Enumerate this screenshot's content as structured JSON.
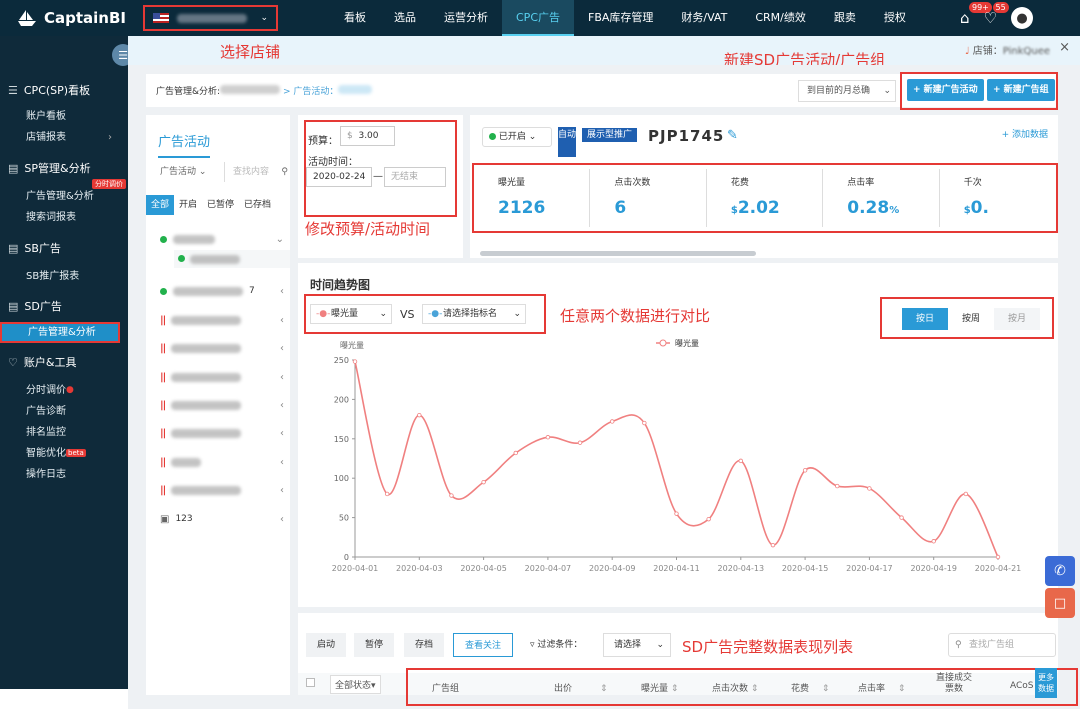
{
  "app": {
    "name": "CaptainBI"
  },
  "nav": [
    "看板",
    "选品",
    "运营分析",
    "CPC广告",
    "FBA库存管理",
    "财务/VAT",
    "CRM/绩效",
    "跟卖",
    "授权"
  ],
  "notifications": {
    "badge1": "99+",
    "badge2": "55"
  },
  "sidebar": {
    "groups": [
      {
        "title": "CPC(SP)看板",
        "items": [
          "账户看板",
          "店铺报表"
        ]
      },
      {
        "title": "SP管理&分析",
        "items": [
          "广告管理&分析",
          "搜索词报表"
        ],
        "tag": "分时调价"
      },
      {
        "title": "SB广告",
        "items": [
          "SB推广报表"
        ]
      },
      {
        "title": "SD广告",
        "items": [
          "广告管理&分析"
        ]
      },
      {
        "title": "账户&工具",
        "items": [
          "分时调价",
          "广告诊断",
          "排名监控",
          "智能优化",
          "操作日志"
        ]
      }
    ],
    "beta": "beta"
  },
  "store": {
    "label": "店铺：",
    "name": "PinkQuee"
  },
  "annotations": {
    "select_store": "选择店铺",
    "new_sd": "新建SD广告活动/广告组",
    "modify_budget": "修改预算/活动时间",
    "compare": "任意两个数据进行对比",
    "full_table": "SD广告完整数据表现列表"
  },
  "breadcrumb": {
    "a": "广告管理&分析:",
    "b": "> 广告活动："
  },
  "period_select": "到目前的月总确",
  "buttons": {
    "new_campaign": "+ 新建广告活动",
    "new_group": "+ 新建广告组"
  },
  "left_panel": {
    "title": "广告活动",
    "filter": "广告活动",
    "search_placeholder": "查找内容",
    "tabs": [
      "全部",
      "开启",
      "已暂停",
      "已存档"
    ],
    "last_item": "123",
    "row_suffix": "7"
  },
  "budget": {
    "label": "预算：",
    "currency": "$",
    "value": "3.00",
    "time_label": "活动时间：",
    "start": "2020-02-24",
    "end_placeholder": "无结束",
    "sep": "—"
  },
  "campaign": {
    "status": "已开启",
    "auto": "自动",
    "type": "展示型推广",
    "asin": "PJP1745",
    "add_data": "+ 添加数据"
  },
  "metrics": [
    {
      "label": "曝光量",
      "value": "2126",
      "prefix": "",
      "suffix": ""
    },
    {
      "label": "点击次数",
      "value": "6",
      "prefix": "",
      "suffix": ""
    },
    {
      "label": "花费",
      "value": "2.02",
      "prefix": "$",
      "suffix": ""
    },
    {
      "label": "点击率",
      "value": "0.28",
      "prefix": "",
      "suffix": "%"
    },
    {
      "label": "千次",
      "value": "0.",
      "prefix": "$",
      "suffix": ""
    }
  ],
  "chart_panel": {
    "title": "时间趋势图",
    "metric1": "曝光量",
    "vs": "VS",
    "metric2": "请选择指标名",
    "granularity": [
      "按日",
      "按周",
      "按月"
    ]
  },
  "chart_data": {
    "type": "line",
    "ylabel": "曝光量",
    "series": [
      {
        "name": "曝光量",
        "color": "#f08080",
        "values": [
          248,
          80,
          180,
          78,
          95,
          132,
          152,
          145,
          172,
          170,
          55,
          48,
          122,
          15,
          110,
          90,
          87,
          50,
          20,
          80,
          0
        ]
      }
    ],
    "x": [
      "2020-04-01",
      "2020-04-02",
      "2020-04-03",
      "2020-04-04",
      "2020-04-05",
      "2020-04-06",
      "2020-04-07",
      "2020-04-08",
      "2020-04-09",
      "2020-04-10",
      "2020-04-11",
      "2020-04-12",
      "2020-04-13",
      "2020-04-14",
      "2020-04-15",
      "2020-04-16",
      "2020-04-17",
      "2020-04-18",
      "2020-04-19",
      "2020-04-20",
      "2020-04-21"
    ],
    "xticks": [
      "2020-04-01",
      "2020-04-03",
      "2020-04-05",
      "2020-04-07",
      "2020-04-09",
      "2020-04-11",
      "2020-04-13",
      "2020-04-15",
      "2020-04-17",
      "2020-04-19",
      "2020-04-21"
    ],
    "ylim": [
      0,
      250
    ],
    "yticks": [
      0,
      50,
      100,
      150,
      200,
      250
    ]
  },
  "table": {
    "actions": [
      "启动",
      "暂停",
      "存档",
      "查看关注"
    ],
    "filter_label": "过滤条件：",
    "filter_value": "请选择",
    "search_placeholder": "查找广告组",
    "status_filter": "全部状态",
    "columns": [
      "广告组",
      "出价",
      "曝光量",
      "点击次数",
      "花费",
      "点击率",
      "直接成交票数",
      "ACoS"
    ],
    "more": "更多数据"
  }
}
